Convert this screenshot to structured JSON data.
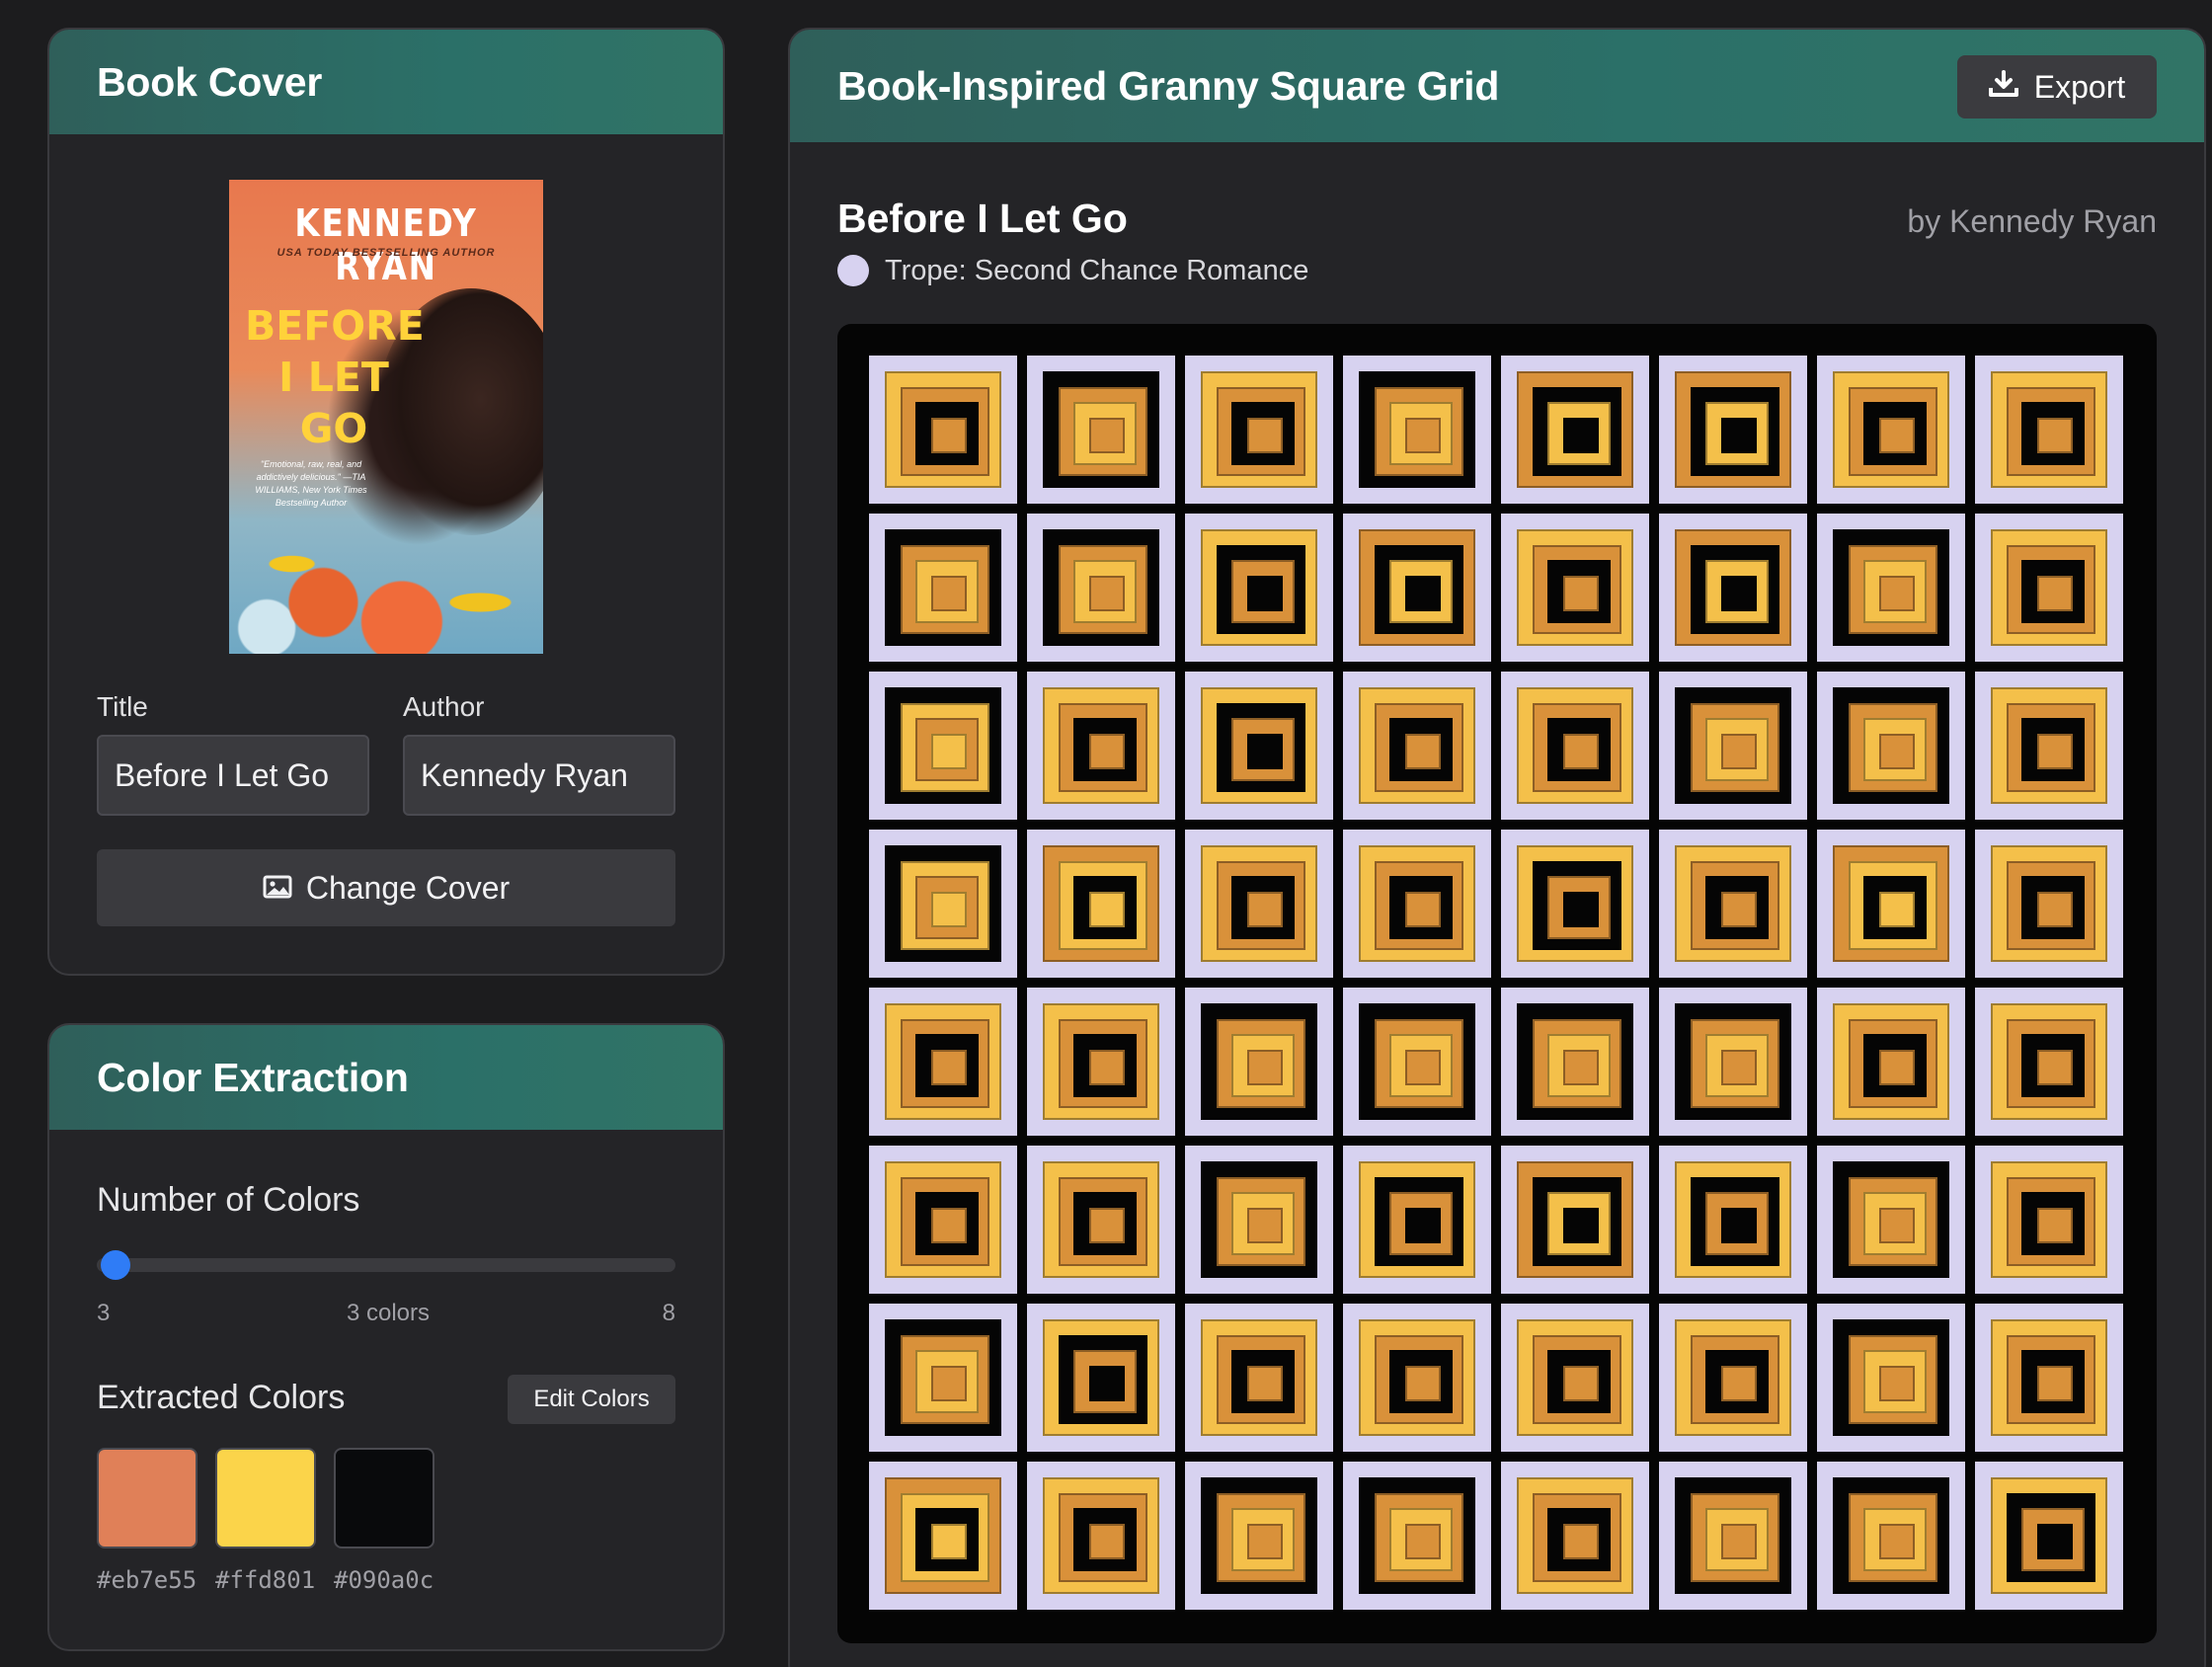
{
  "cover_panel": {
    "title": "Book Cover",
    "cover": {
      "author": "KENNEDY RYAN",
      "tagline": "USA TODAY BESTSELLING AUTHOR",
      "title_lines": [
        "BEFORE",
        "I LET",
        "GO"
      ],
      "quote": "\"Emotional, raw, real, and addictively delicious.\" —TIA WILLIAMS, New York Times Bestselling Author"
    },
    "title_label": "Title",
    "title_value": "Before I Let Go",
    "author_label": "Author",
    "author_value": "Kennedy Ryan",
    "change_cover_label": "Change Cover",
    "change_cover_icon": "image-icon"
  },
  "color_panel": {
    "title": "Color Extraction",
    "num_colors_label": "Number of Colors",
    "slider": {
      "min": "3",
      "max": "8",
      "value": 3,
      "value_label": "3 colors"
    },
    "extracted_label": "Extracted Colors",
    "edit_label": "Edit Colors",
    "swatches": [
      {
        "hex": "#eb7e55"
      },
      {
        "hex": "#ffd801"
      },
      {
        "hex": "#090a0c"
      }
    ]
  },
  "grid_panel": {
    "title": "Book-Inspired Granny Square Grid",
    "export_label": "Export",
    "export_icon": "download-icon",
    "book_title": "Before I Let Go",
    "book_author": "by Kennedy Ryan",
    "trope": "Trope: Second Chance Romance",
    "trope_color": "#d7d2f0"
  },
  "colors": {
    "border": "#d7d2f0",
    "orange": "#d9913a",
    "yellow": "#f4c04a",
    "black": "#050505"
  },
  "grid_rows": [
    [
      "YOB",
      "BOY",
      "YOB",
      "BOY",
      "OBY",
      "OBY",
      "YOB",
      "YOB"
    ],
    [
      "BOY",
      "BOY",
      "YBO",
      "OBY",
      "YOB",
      "OBY",
      "BOY",
      "YOB"
    ],
    [
      "BYO",
      "YOB",
      "YBO",
      "YOB",
      "YOB",
      "BOY",
      "BOY",
      "YOB"
    ],
    [
      "BYO",
      "OYB",
      "YOB",
      "YOB",
      "YBO",
      "YOB",
      "OYB",
      "YOB"
    ],
    [
      "YOB",
      "YOB",
      "BOY",
      "BOY",
      "BOY",
      "BOY",
      "YOB",
      "YOB"
    ],
    [
      "YOB",
      "YOB",
      "BOY",
      "YBO",
      "OBY",
      "YBO",
      "BOY",
      "YOB"
    ],
    [
      "BOY",
      "YBO",
      "YOB",
      "YOB",
      "YOB",
      "YOB",
      "BOY",
      "YOB"
    ],
    [
      "OYB",
      "YOB",
      "BOY",
      "BOY",
      "YOB",
      "BOY",
      "BOY",
      "YBO"
    ]
  ]
}
